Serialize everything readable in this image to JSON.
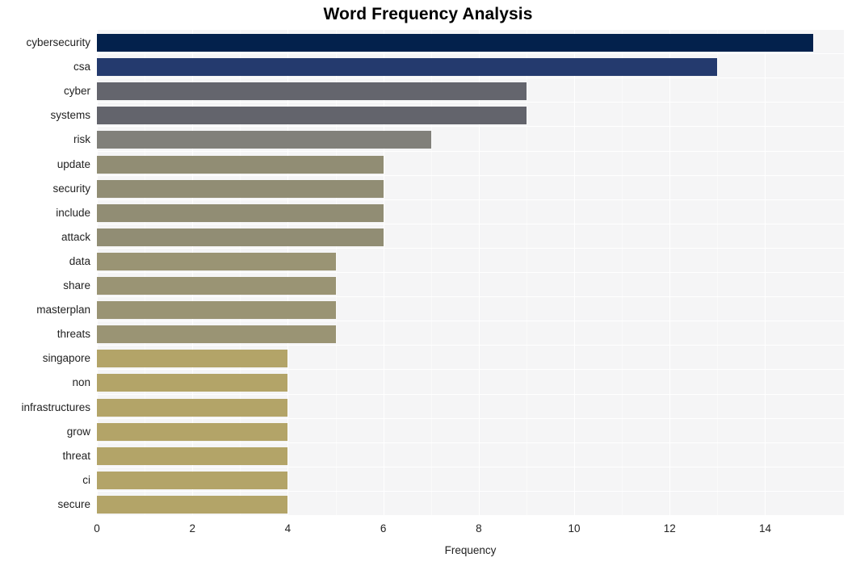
{
  "chart_data": {
    "type": "bar",
    "orientation": "horizontal",
    "title": "Word Frequency Analysis",
    "xlabel": "Frequency",
    "ylabel": "",
    "xlim": [
      0,
      15.65
    ],
    "xticks": [
      0,
      2,
      4,
      6,
      8,
      10,
      12,
      14
    ],
    "xtick_labels": [
      "0",
      "2",
      "4",
      "6",
      "8",
      "10",
      "12",
      "14"
    ],
    "grid": true,
    "grid_color": "#ffffff",
    "panel_background": "#f5f5f6",
    "legend": "none",
    "categories": [
      "cybersecurity",
      "csa",
      "cyber",
      "systems",
      "risk",
      "update",
      "security",
      "include",
      "attack",
      "data",
      "share",
      "masterplan",
      "threats",
      "singapore",
      "non",
      "infrastructures",
      "grow",
      "threat",
      "ci",
      "secure"
    ],
    "values": [
      15,
      13,
      9,
      9,
      7,
      6,
      6,
      6,
      6,
      5,
      5,
      5,
      5,
      4,
      4,
      4,
      4,
      4,
      4,
      4
    ],
    "bar_colors": [
      "#03214c",
      "#243a6e",
      "#64656d",
      "#63646c",
      "#81807a",
      "#918d74",
      "#918d74",
      "#918d74",
      "#918d74",
      "#9a9474",
      "#9a9474",
      "#9a9474",
      "#9a9474",
      "#b3a468",
      "#b3a468",
      "#b3a468",
      "#b3a468",
      "#b3a468",
      "#b3a468",
      "#b3a468"
    ]
  }
}
